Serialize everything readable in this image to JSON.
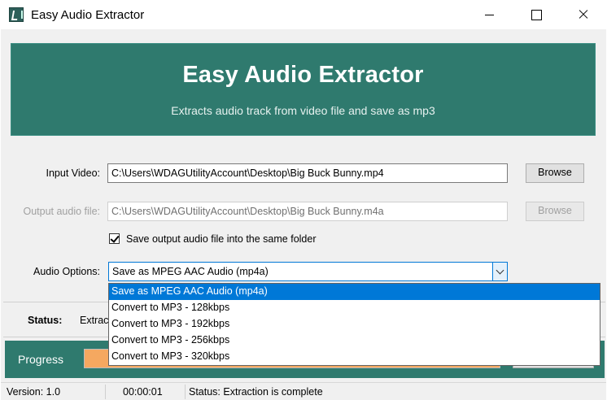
{
  "window": {
    "title": "Easy Audio Extractor"
  },
  "banner": {
    "title": "Easy Audio Extractor",
    "subtitle": "Extracts audio track from video file and save as mp3"
  },
  "input_video": {
    "label": "Input Video:",
    "value": "C:\\Users\\WDAGUtilityAccount\\Desktop\\Big Buck Bunny.mp4",
    "browse_label": "Browse"
  },
  "output_audio": {
    "label": "Output audio file:",
    "value": "C:\\Users\\WDAGUtilityAccount\\Desktop\\Big Buck Bunny.m4a",
    "browse_label": "Browse",
    "enabled": false
  },
  "same_folder": {
    "label": "Save output audio file into the same folder",
    "checked": true
  },
  "audio_options": {
    "label": "Audio Options:",
    "selected": "Save as MPEG AAC Audio (mp4a)",
    "options": [
      "Save as MPEG AAC Audio (mp4a)",
      "Convert to MP3 - 128kbps",
      "Convert to MP3 - 192kbps",
      "Convert to MP3 - 256kbps",
      "Convert to MP3 - 320kbps"
    ],
    "selected_index": 0
  },
  "status_panel": {
    "label": "Status:",
    "value": "Extrac"
  },
  "progress": {
    "label": "Progress",
    "fraction": 1.0
  },
  "statusbar": {
    "version": "Version: 1.0",
    "elapsed": "00:00:01",
    "status": "Status: Extraction is complete"
  },
  "colors": {
    "accent_teal": "#2f7a6e",
    "progress_fill": "#f5a860",
    "selection_blue": "#0078d7"
  }
}
